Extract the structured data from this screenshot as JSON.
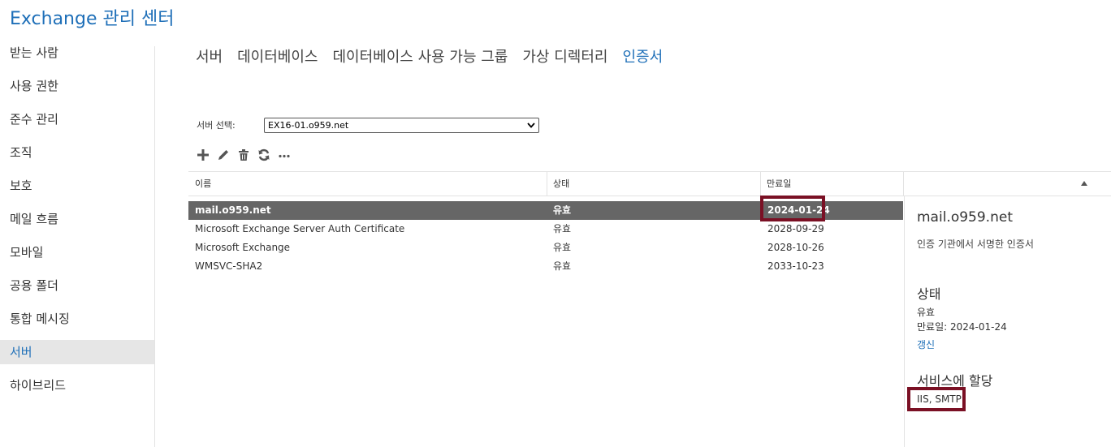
{
  "app": {
    "title": "Exchange 관리 센터"
  },
  "colors": {
    "accent": "#1e6fb8",
    "selected_row": "#666666",
    "highlight_border": "#7a1024"
  },
  "sidebar": {
    "items": [
      {
        "label": "받는 사람"
      },
      {
        "label": "사용 권한"
      },
      {
        "label": "준수 관리"
      },
      {
        "label": "조직"
      },
      {
        "label": "보호"
      },
      {
        "label": "메일 흐름"
      },
      {
        "label": "모바일"
      },
      {
        "label": "공용 폴더"
      },
      {
        "label": "통합 메시징"
      },
      {
        "label": "서버",
        "active": true
      },
      {
        "label": "하이브리드"
      }
    ]
  },
  "tabs": [
    {
      "label": "서버"
    },
    {
      "label": "데이터베이스"
    },
    {
      "label": "데이터베이스 사용 가능 그룹"
    },
    {
      "label": "가상 디렉터리"
    },
    {
      "label": "인증서",
      "active": true
    }
  ],
  "server_select": {
    "label": "서버 선택:",
    "value": "EX16-01.o959.net"
  },
  "toolbar": {
    "icons": [
      "add-icon",
      "edit-icon",
      "delete-icon",
      "refresh-icon",
      "more-icon"
    ]
  },
  "table": {
    "headers": {
      "name": "이름",
      "status": "상태",
      "expiration": "만료일"
    },
    "sort": "expiration-ascending",
    "rows": [
      {
        "name": "mail.o959.net",
        "status": "유효",
        "expiration": "2024-01-24",
        "selected": true
      },
      {
        "name": "Microsoft Exchange Server Auth Certificate",
        "status": "유효",
        "expiration": "2028-09-29"
      },
      {
        "name": "Microsoft Exchange",
        "status": "유효",
        "expiration": "2028-10-26"
      },
      {
        "name": "WMSVC-SHA2",
        "status": "유효",
        "expiration": "2033-10-23"
      }
    ]
  },
  "details": {
    "title": "mail.o959.net",
    "subtitle": "인증 기관에서 서명한 인증서",
    "status_heading": "상태",
    "status_value": "유효",
    "expiration_text": "만료일: 2024-01-24",
    "renew_link": "갱신",
    "services_heading": "서비스에 할당",
    "services_value": "IIS, SMTP"
  }
}
